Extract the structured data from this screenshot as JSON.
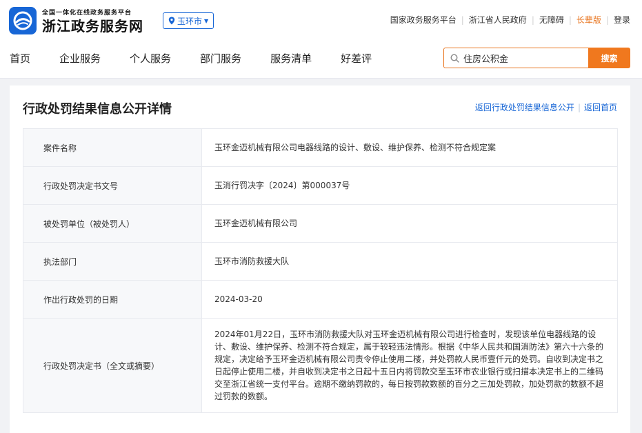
{
  "header": {
    "logo_small": "全国一体化在线政务服务平台",
    "logo_big": "浙江政务服务网",
    "city": "玉环市",
    "top_links": [
      "国家政务服务平台",
      "浙江省人民政府",
      "无障碍",
      "长辈版",
      "登录"
    ],
    "elder_color": "#e8741e"
  },
  "nav": {
    "items": [
      "首页",
      "企业服务",
      "个人服务",
      "部门服务",
      "服务清单",
      "好差评"
    ]
  },
  "search": {
    "value": "住房公积金",
    "button": "搜索",
    "accent": "#f0781e"
  },
  "panel": {
    "title": "行政处罚结果信息公开详情",
    "link_back": "返回行政处罚结果信息公开",
    "link_home": "返回首页"
  },
  "details": [
    {
      "label": "案件名称",
      "value": "玉环金迈机械有限公司电器线路的设计、敷设、维护保养、检测不符合规定案"
    },
    {
      "label": "行政处罚决定书文号",
      "value": "玉消行罚决字〔2024〕第000037号"
    },
    {
      "label": "被处罚单位（被处罚人）",
      "value": "玉环金迈机械有限公司"
    },
    {
      "label": "执法部门",
      "value": "玉环市消防救援大队"
    },
    {
      "label": "作出行政处罚的日期",
      "value": "2024-03-20"
    },
    {
      "label": "行政处罚决定书（全文或摘要）",
      "value": "2024年01月22日，玉环市消防救援大队对玉环金迈机械有限公司进行检查时，发现该单位电器线路的设计、敷设、维护保养、检测不符合规定，属于较轻违法情形。根据《中华人民共和国消防法》第六十六条的规定，决定给予玉环金迈机械有限公司责令停止使用二楼，并处罚款人民币壹仟元的处罚。自收到决定书之日起停止使用二楼，并自收到决定书之日起十五日内将罚款交至玉环市农业银行或扫描本决定书上的二维码交至浙江省统一支付平台。逾期不缴纳罚款的，每日按罚款数额的百分之三加处罚款，加处罚款的数额不超过罚款的数额。"
    }
  ],
  "colors": {
    "brand_blue": "#1766d6",
    "link_blue": "#1766d6"
  }
}
